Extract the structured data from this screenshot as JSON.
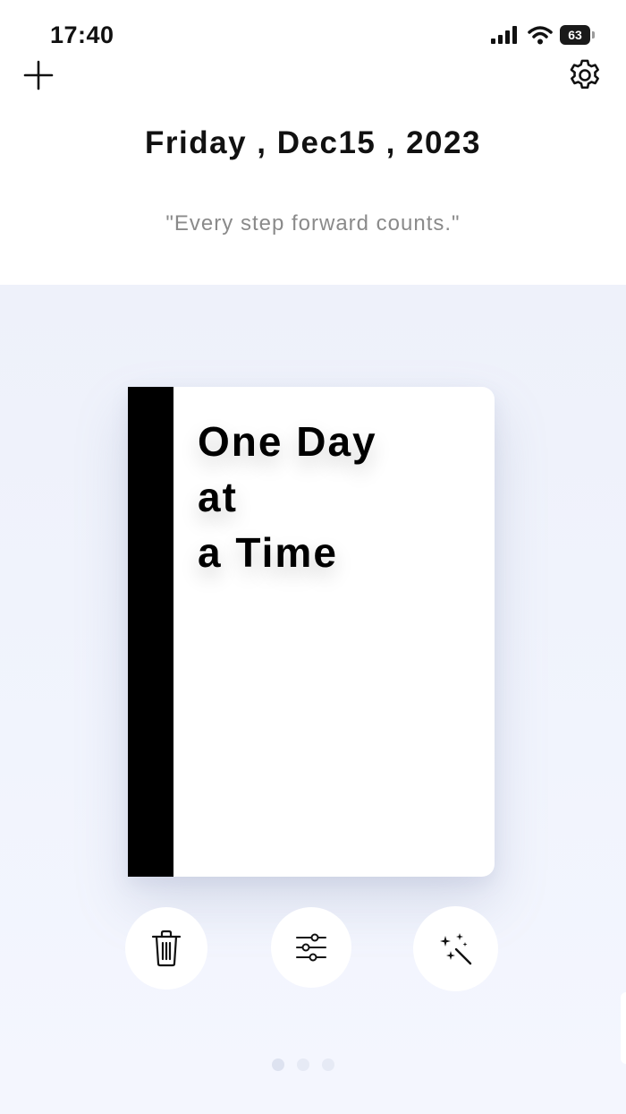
{
  "status_bar": {
    "time": "17:40",
    "battery": "63",
    "icons": [
      "signal-icon",
      "wifi-icon",
      "battery-icon"
    ]
  },
  "header": {
    "add_icon": "plus-icon",
    "settings_icon": "gear-icon",
    "date": "Friday , Dec15 , 2023",
    "quote": "\"Every step forward counts.\""
  },
  "book": {
    "title_lines": [
      "One Day",
      "at",
      "a Time"
    ],
    "spine_color": "#000000",
    "cover_color": "#ffffff"
  },
  "actions": [
    {
      "name": "delete",
      "icon": "trash-icon"
    },
    {
      "name": "adjust",
      "icon": "sliders-icon"
    },
    {
      "name": "magic",
      "icon": "magic-wand-icon"
    }
  ],
  "pager": {
    "count": 3,
    "active_index": 0
  },
  "colors": {
    "panel_background": "#eef1fa",
    "text_primary": "#111111",
    "text_secondary": "#8a8a8a"
  }
}
